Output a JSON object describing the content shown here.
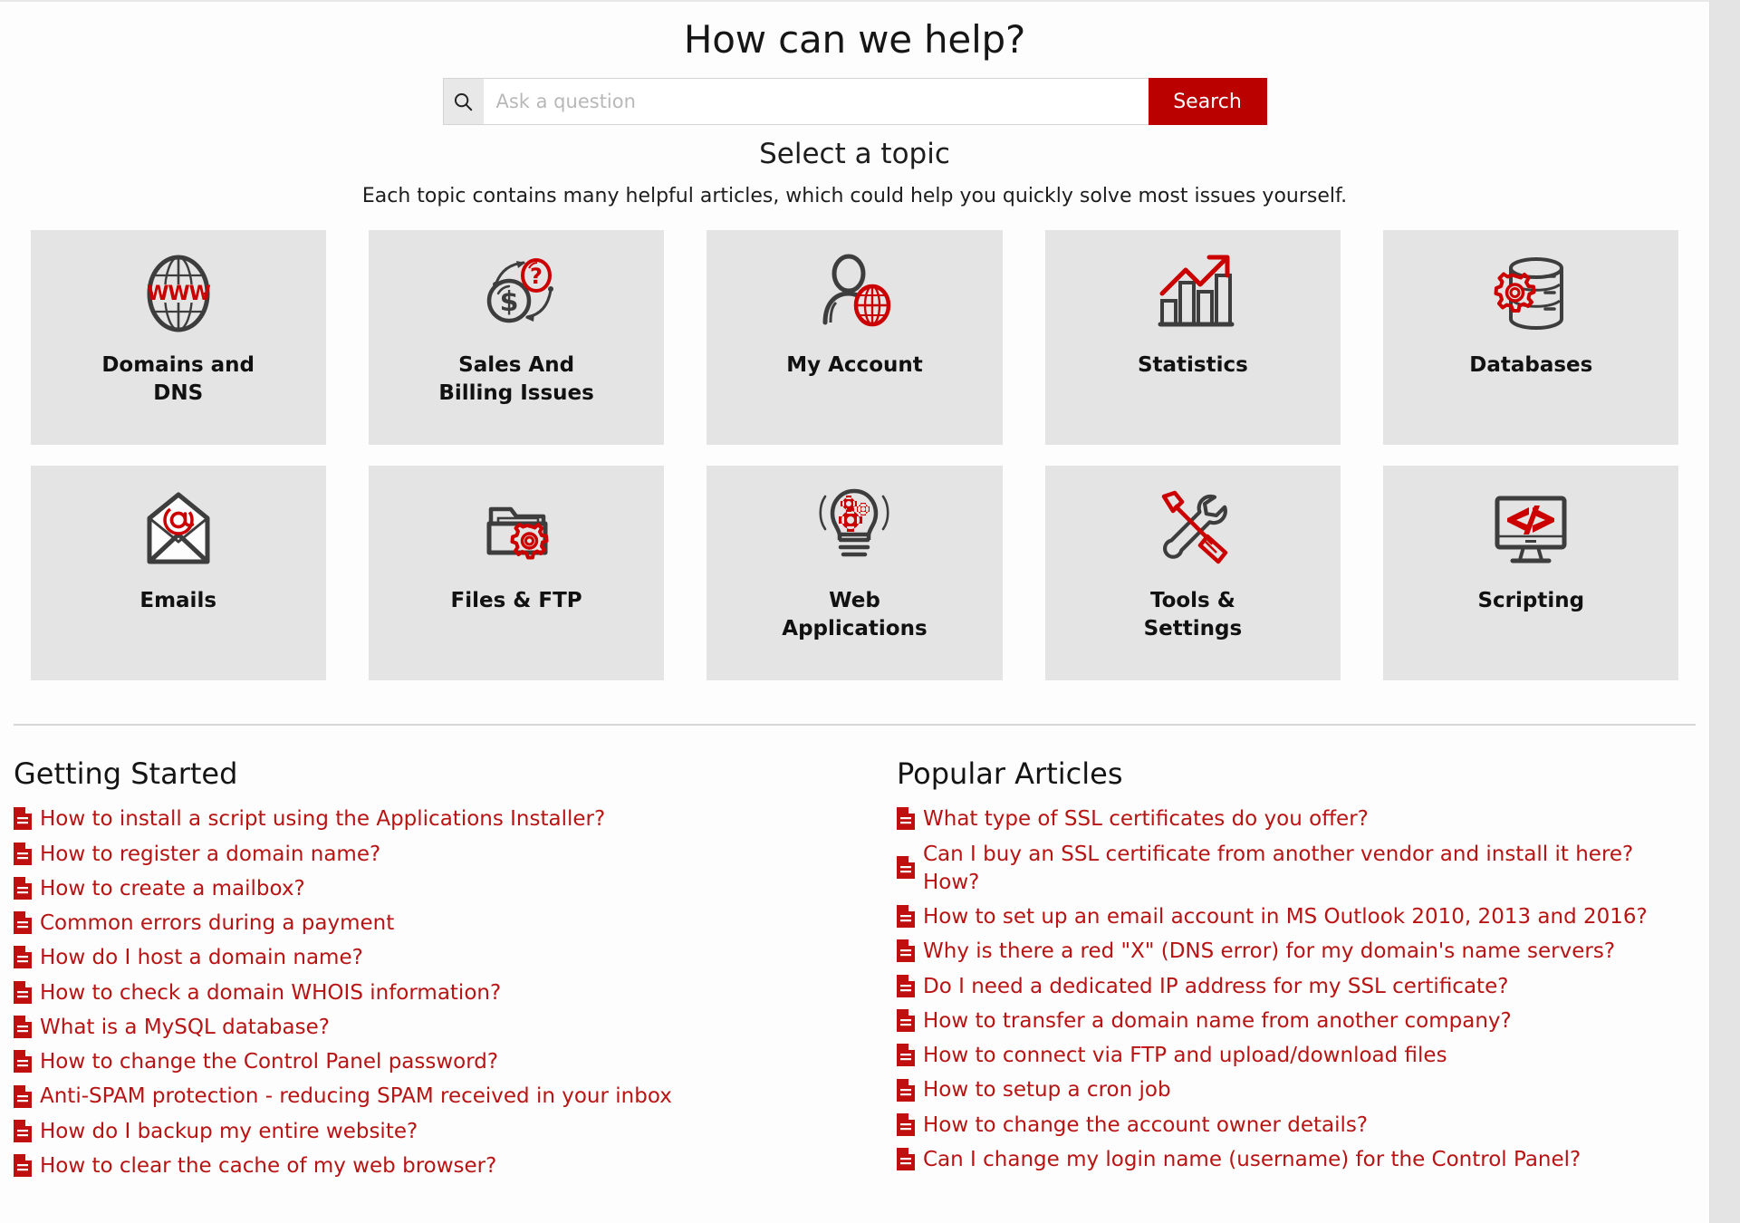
{
  "hero": {
    "title": "How can we help?",
    "search_placeholder": "Ask a question",
    "search_value": "",
    "search_button": "Search",
    "search_icon": "search-icon",
    "subtitle": "Select a topic",
    "description": "Each topic contains many helpful articles, which could help you quickly solve most issues yourself."
  },
  "colors": {
    "brand_red": "#bb0000",
    "link_red": "#b81414",
    "card_gray": "#e4e4e4",
    "icon_dark": "#3d3d3d"
  },
  "topics": [
    {
      "label": "Domains and DNS",
      "icon": "globe-www-icon"
    },
    {
      "label": "Sales And Billing Issues",
      "icon": "billing-dollar-question-icon"
    },
    {
      "label": "My Account",
      "icon": "user-globe-icon"
    },
    {
      "label": "Statistics",
      "icon": "bar-chart-arrow-icon"
    },
    {
      "label": "Databases",
      "icon": "database-gear-icon"
    },
    {
      "label": "Emails",
      "icon": "envelope-at-icon"
    },
    {
      "label": "Files & FTP",
      "icon": "folder-gear-icon"
    },
    {
      "label": "Web Applications",
      "icon": "lightbulb-gears-icon"
    },
    {
      "label": "Tools & Settings",
      "icon": "wrench-screwdriver-icon"
    },
    {
      "label": "Scripting",
      "icon": "monitor-code-icon"
    }
  ],
  "getting_started": {
    "heading": "Getting Started",
    "articles": [
      "How to install a script using the Applications Installer?",
      "How to register a domain name?",
      "How to create a mailbox?",
      "Common errors during a payment",
      "How do I host a domain name?",
      "How to check a domain WHOIS information?",
      "What is a MySQL database?",
      "How to change the Control Panel password?",
      "Anti-SPAM protection - reducing SPAM received in your inbox",
      "How do I backup my entire website?",
      "How to clear the cache of my web browser?"
    ]
  },
  "popular_articles": {
    "heading": "Popular Articles",
    "articles": [
      "What type of SSL certificates do you offer?",
      "Can I buy an SSL certificate from another vendor and install it here? How?",
      "How to set up an email account in MS Outlook 2010, 2013 and 2016?",
      "Why is there a red \"X\" (DNS error) for my domain's name servers?",
      "Do I need a dedicated IP address for my SSL certificate?",
      "How to transfer a domain name from another company?",
      "How to connect via FTP and upload/download files",
      "How to setup a cron job",
      "How to change the account owner details?",
      "Can I change my login name (username) for the Control Panel?"
    ]
  }
}
